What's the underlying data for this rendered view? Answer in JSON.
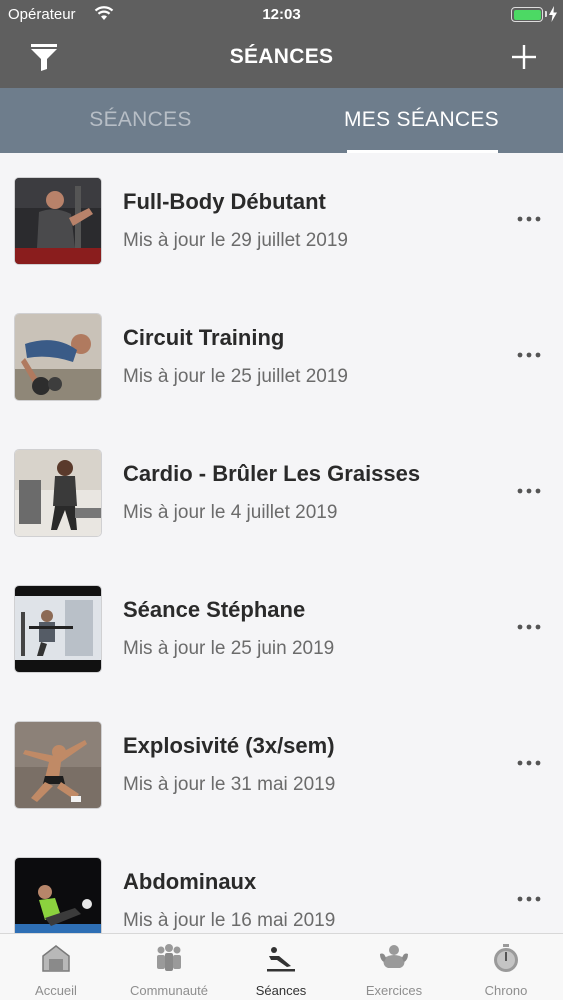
{
  "status_bar": {
    "carrier": "Opérateur",
    "time": "12:03"
  },
  "navbar": {
    "title": "SÉANCES",
    "filter_icon": "filter-icon",
    "add_icon": "plus-icon"
  },
  "tabs": [
    {
      "label": "SÉANCES",
      "selected": false
    },
    {
      "label": "MES SÉANCES",
      "selected": true
    }
  ],
  "sessions": [
    {
      "name": "Full-Body Débutant",
      "date": "Mis à jour le 29 juillet 2019"
    },
    {
      "name": "Circuit Training",
      "date": "Mis à jour le 25 juillet 2019"
    },
    {
      "name": "Cardio - Brûler Les Graisses",
      "date": "Mis à jour le 4 juillet 2019"
    },
    {
      "name": "Séance Stéphane",
      "date": "Mis à jour le 25 juin 2019"
    },
    {
      "name": "Explosivité (3x/sem)",
      "date": "Mis à jour le 31 mai 2019"
    },
    {
      "name": "Abdominaux",
      "date": "Mis à jour le 16 mai 2019"
    }
  ],
  "bottom_tabs": [
    {
      "label": "Accueil",
      "icon": "home-icon"
    },
    {
      "label": "Communauté",
      "icon": "community-icon"
    },
    {
      "label": "Séances",
      "icon": "workout-icon",
      "active": true
    },
    {
      "label": "Exercices",
      "icon": "muscle-icon"
    },
    {
      "label": "Chrono",
      "icon": "stopwatch-icon"
    }
  ],
  "colors": {
    "header": "#5f5f5f",
    "tabs_bg": "#6e7d8c",
    "battery": "#4cd964"
  }
}
